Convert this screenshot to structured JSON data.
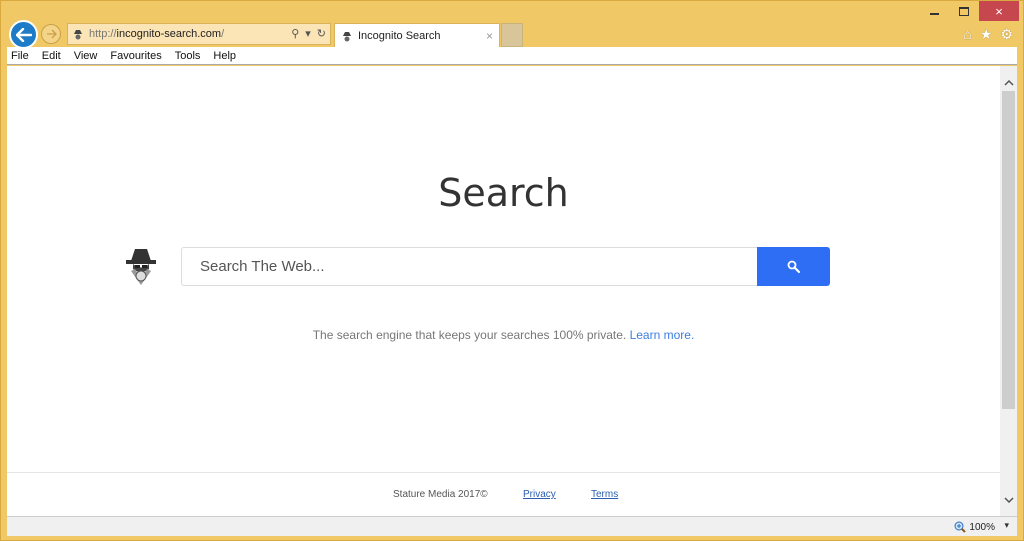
{
  "window": {
    "controls": {
      "minimize": "minimize",
      "maximize": "maximize",
      "close": "×"
    }
  },
  "navbar": {
    "url_proto": "http://",
    "url_host": "incognito-search.com",
    "url_rest": "/",
    "search_icon": "⚲",
    "dropdown_icon": "▾",
    "refresh_icon": "↻"
  },
  "tab": {
    "title": "Incognito Search",
    "close": "×"
  },
  "toolbar_icons": {
    "home": "⌂",
    "favorites": "★",
    "settings": "⚙"
  },
  "menu": [
    "File",
    "Edit",
    "View",
    "Favourites",
    "Tools",
    "Help"
  ],
  "page": {
    "title": "Search",
    "search_placeholder": "Search The Web...",
    "search_value": "",
    "tagline": "The search engine that keeps your searches 100% private.",
    "learn_more": "Learn more.",
    "accent_color": "#2e6ef5"
  },
  "footer": {
    "copyright": "Stature Media 2017©",
    "privacy": "Privacy",
    "terms": "Terms"
  },
  "statusbar": {
    "zoom": "100%"
  }
}
